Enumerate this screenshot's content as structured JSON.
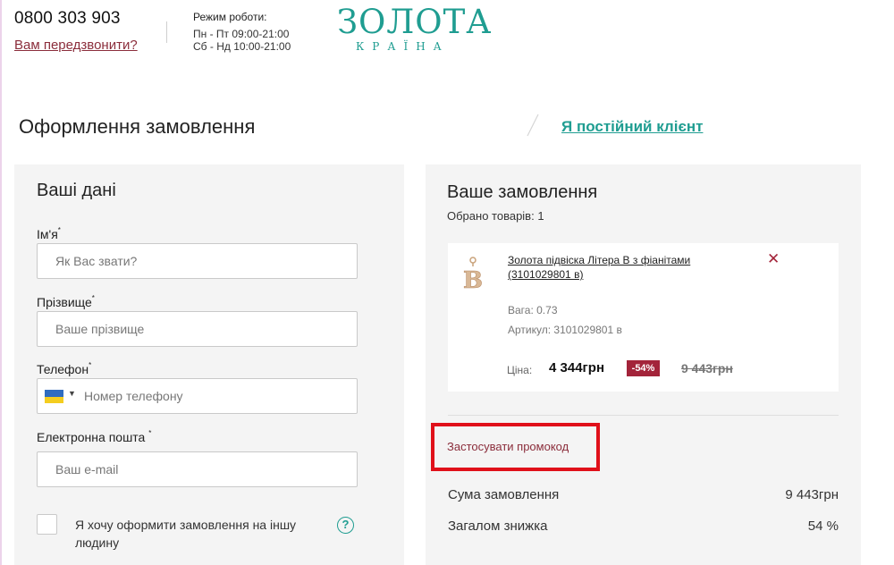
{
  "header": {
    "phone": "0800 303 903",
    "callback_link": "Вам передзвонити?",
    "hours_title": "Режим роботи:",
    "hours_weekdays": "Пн - Пт 09:00-21:00",
    "hours_weekend": "Сб - Нд 10:00-21:00",
    "logo_main": "ЗОЛОТА",
    "logo_sub": "КРАЇНА"
  },
  "page": {
    "title": "Оформлення замовлення",
    "regular_customer_link": "Я постійний клієнт"
  },
  "customer_form": {
    "title": "Ваші дані",
    "first_name": {
      "label": "Ім'я",
      "placeholder": "Як Вас звати?"
    },
    "last_name": {
      "label": "Прізвище",
      "placeholder": "Ваше прізвище"
    },
    "phone": {
      "label": "Телефон",
      "placeholder": "Номер телефону"
    },
    "email": {
      "label": "Електронна пошта",
      "placeholder": "Ваш e-mail"
    },
    "other_person_checkbox": "Я хочу оформити замовлення на іншу людину",
    "required_mark": "*",
    "help_glyph": "?"
  },
  "order": {
    "title": "Ваше замовлення",
    "items_count": "Обрано товарів: 1",
    "item": {
      "name": "Золота підвіска Літера B з фіанітами (3101029801 в)",
      "weight": "Вага: 0.73",
      "article": "Артикул: 3101029801 в",
      "price_label": "Ціна:",
      "price_new": "4 344грн",
      "discount": "-54%",
      "price_old": "9 443грн",
      "thumb_letter": "B",
      "remove_glyph": "✕"
    },
    "promo_link": "Застосувати промокод",
    "summary": {
      "sum_label": "Сума замовлення",
      "sum_value": "9 443грн",
      "discount_label": "Загалом знижка",
      "discount_value": "54 %"
    }
  },
  "colors": {
    "teal": "#1f9d91",
    "accent_red": "#a3243a",
    "highlight_box": "#e0101a"
  },
  "icons": {
    "flag": "ukraine-flag-icon",
    "caret": "caret-down-icon",
    "help": "question-circle-icon",
    "remove": "close-icon"
  }
}
